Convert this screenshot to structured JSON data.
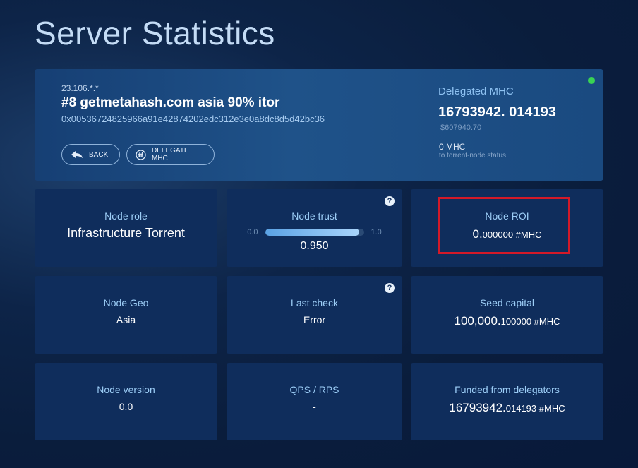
{
  "page": {
    "title": "Server Statistics"
  },
  "server": {
    "ip": "23.106.*.*",
    "name": "#8 getmetahash.com asia 90% itor",
    "address": "0x00536724825966a91e42874202edc312e3e0a8dc8d5d42bc36",
    "status_color": "#39d353",
    "buttons": {
      "back": "BACK",
      "delegate": "DELEGATE MHC"
    },
    "delegated": {
      "label": "Delegated MHC",
      "value": "16793942. 014193",
      "usd": "$607940.70",
      "status_value": "0 MHC",
      "status_sub": "to torrent-node status"
    }
  },
  "tiles": {
    "role": {
      "label": "Node role",
      "value": "Infrastructure Torrent"
    },
    "trust": {
      "label": "Node trust",
      "min": "0.0",
      "max": "1.0",
      "value": "0.950",
      "level": 0.95
    },
    "roi": {
      "label": "Node ROI",
      "value_main": "0.",
      "value_frac": "000000",
      "value_unit": " #MHC"
    },
    "geo": {
      "label": "Node Geo",
      "value": "Asia"
    },
    "last_check": {
      "label": "Last check",
      "value": "Error"
    },
    "seed": {
      "label": "Seed capital",
      "value_main": "100,000.",
      "value_frac": "100000",
      "value_unit": " #MHC"
    },
    "version": {
      "label": "Node version",
      "value": "0.0"
    },
    "qps": {
      "label": "QPS / RPS",
      "value": "-"
    },
    "funded": {
      "label": "Funded from delegators",
      "value_main": "16793942.",
      "value_frac": "014193",
      "value_unit": " #MHC"
    }
  },
  "help_icon": "?"
}
